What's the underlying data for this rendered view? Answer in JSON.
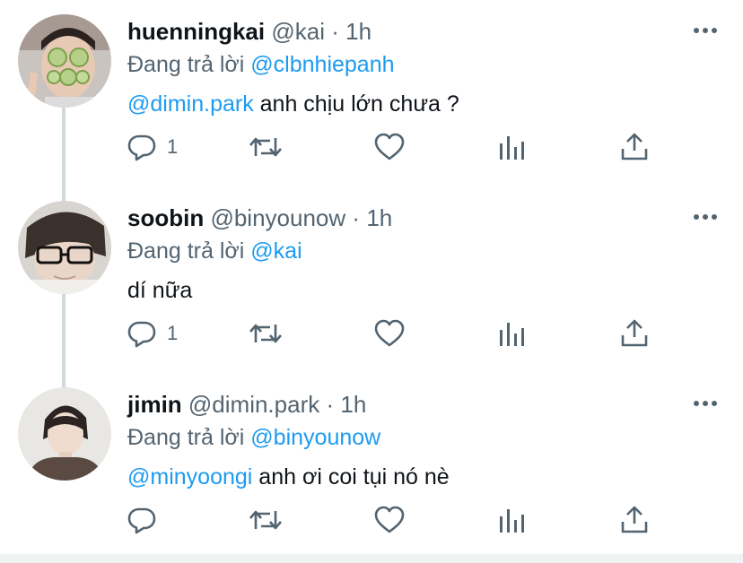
{
  "tweets": [
    {
      "name": "huenningkai",
      "handle": "@kai",
      "dot": "·",
      "time": "1h",
      "reply_prefix": "Đang trả lời",
      "reply_to": "@clbnhiepanh",
      "text_mention": "@dimin.park",
      "text": " anh chịu lớn chưa ?",
      "reply_count": "1",
      "avatar_icon": "avatar-photo-face-mask"
    },
    {
      "name": "soobin",
      "handle": "@binyounow",
      "dot": "·",
      "time": "1h",
      "reply_prefix": "Đang trả lời",
      "reply_to": "@kai",
      "text_mention": "",
      "text": "dí nữa",
      "reply_count": "1",
      "avatar_icon": "avatar-photo-glasses"
    },
    {
      "name": "jimin",
      "handle": "@dimin.park",
      "dot": "·",
      "time": "1h",
      "reply_prefix": "Đang trả lời",
      "reply_to": "@binyounow",
      "text_mention": "@minyoongi",
      "text": " anh ơi coi tụi nó nè",
      "reply_count": "",
      "avatar_icon": "avatar-photo-portrait"
    }
  ],
  "colors": {
    "accent": "#1d9bf0",
    "secondary_text": "#536471",
    "primary_text": "#0f1419",
    "thread_line": "#cfd9de"
  }
}
